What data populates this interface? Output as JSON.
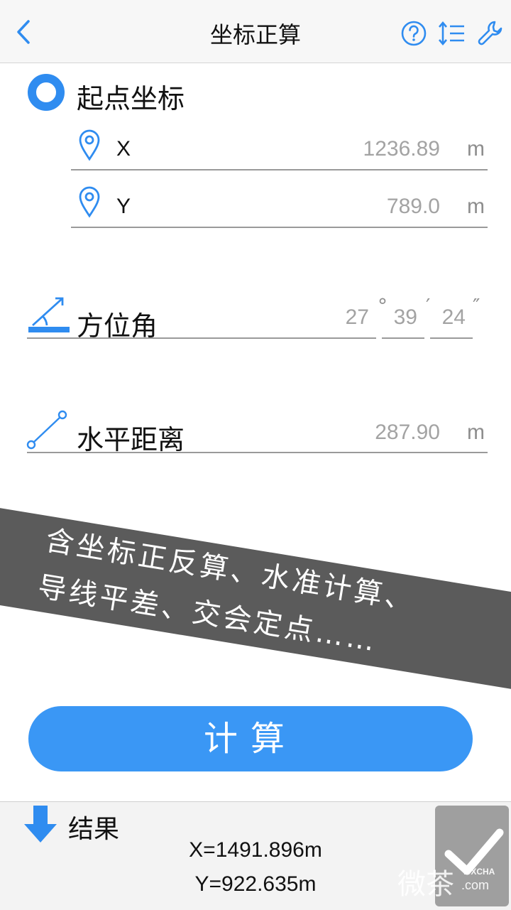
{
  "header": {
    "title": "坐标正算"
  },
  "start_section": {
    "label": "起点坐标"
  },
  "fields": {
    "x": {
      "label": "X",
      "value": "1236.89",
      "unit": "m"
    },
    "y": {
      "label": "Y",
      "value": "789.0",
      "unit": "m"
    }
  },
  "azimuth": {
    "label": "方位角",
    "deg": "27",
    "min": "39",
    "sec": "24",
    "deg_symbol": "°",
    "min_symbol": "′",
    "sec_symbol": "″"
  },
  "distance": {
    "label": "水平距离",
    "value": "287.90",
    "unit": "m"
  },
  "promo": {
    "line1": "含坐标正反算、水准计算、",
    "line2": "导线平差、交会定点……"
  },
  "calculate_button": {
    "label": "计算"
  },
  "result": {
    "label": "结果",
    "x": "X=1491.896m",
    "y": "Y=922.635m"
  },
  "watermark": {
    "brand": "WXCHA",
    "text": "微茶",
    "domain": ".com"
  },
  "colors": {
    "accent": "#2f8cf0",
    "button": "#3a97f5",
    "banner": "#5b5b5b"
  }
}
